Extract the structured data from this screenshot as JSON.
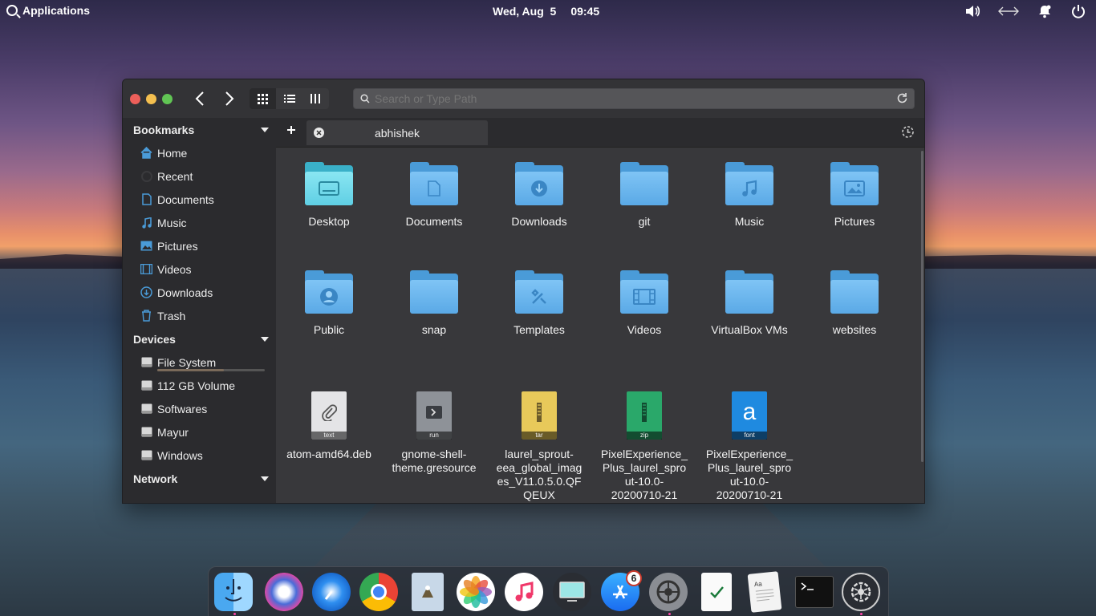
{
  "panel": {
    "applications_label": "Applications",
    "date": "Wed, Aug  5",
    "time": "09:45"
  },
  "window": {
    "path_placeholder": "Search or Type Path",
    "tab_title": "abhishek"
  },
  "sidebar": {
    "bookmarks_header": "Bookmarks",
    "bookmarks": [
      {
        "label": "Home",
        "icon": "home-icon"
      },
      {
        "label": "Recent",
        "icon": "clock-icon"
      },
      {
        "label": "Documents",
        "icon": "document-icon"
      },
      {
        "label": "Music",
        "icon": "music-note-icon"
      },
      {
        "label": "Pictures",
        "icon": "picture-icon"
      },
      {
        "label": "Videos",
        "icon": "film-icon"
      },
      {
        "label": "Downloads",
        "icon": "download-icon"
      },
      {
        "label": "Trash",
        "icon": "trash-icon"
      }
    ],
    "devices_header": "Devices",
    "devices": [
      {
        "label": "File System",
        "usage_fraction": 0.62
      },
      {
        "label": "112 GB Volume"
      },
      {
        "label": "Softwares"
      },
      {
        "label": "Mayur"
      },
      {
        "label": "Windows"
      }
    ],
    "network_header": "Network"
  },
  "files": {
    "row1": [
      "Desktop",
      "Documents",
      "Downloads",
      "git",
      "Music",
      "Pictures"
    ],
    "row2": [
      "Public",
      "snap",
      "Templates",
      "Videos",
      "VirtualBox VMs",
      "websites"
    ],
    "row3": [
      {
        "label": "atom-amd64.deb",
        "tag": "text"
      },
      {
        "label": "gnome-shell-theme.gresource",
        "tag": "run"
      },
      {
        "label": "laurel_sprout-eea_global_images_V11.0.5.0.QFQEUX",
        "tag": "tar"
      },
      {
        "label": "PixelExperience_Plus_laurel_sprout-10.0-20200710-21",
        "tag": "zip"
      },
      {
        "label": "PixelExperience_Plus_laurel_sprout-10.0-20200710-21",
        "tag": "font"
      }
    ]
  },
  "dock": {
    "app_store_badge": "6",
    "apps": [
      "finder-icon",
      "siri-icon",
      "safari-icon",
      "chrome-icon",
      "mail-icon",
      "photos-icon",
      "music-icon",
      "display-icon",
      "app-store-icon",
      "system-settings-icon",
      "checklist-icon",
      "text-editor-icon",
      "terminal-icon",
      "settings-gear-icon"
    ]
  },
  "colors": {
    "accent": "#4a9bd8",
    "window_bg": "#333336",
    "sidebar_bg": "#2b2b2e",
    "content_bg": "#38383b"
  }
}
